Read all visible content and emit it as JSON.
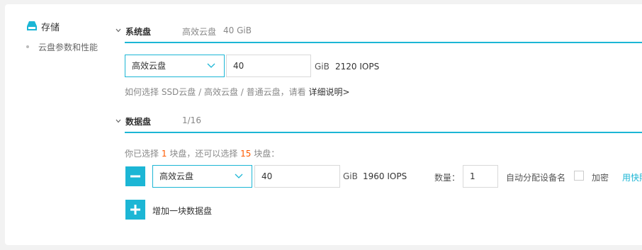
{
  "nav": {
    "title": "存储",
    "sub_item": "云盘参数和性能"
  },
  "system_disk": {
    "title": "系统盘",
    "summary_type": "高效云盘",
    "summary_size": "40 GiB",
    "type_value": "高效云盘",
    "size_value": "40",
    "unit": "GiB",
    "iops": "2120 IOPS",
    "hint_text": "如何选择 SSD云盘 / 高效云盘 / 普通云盘，请看",
    "hint_link": "详细说明>"
  },
  "data_disk": {
    "title": "数据盘",
    "count_summary": "1/16",
    "selected_prefix": "你已选择",
    "selected_count": "1",
    "selected_mid": "块盘，还可以选择",
    "remaining_count": "15",
    "selected_suffix": "块盘：",
    "type_value": "高效云盘",
    "size_value": "40",
    "unit": "GiB",
    "iops": "1960 IOPS",
    "quantity_label": "数量：",
    "quantity_value": "1",
    "auto_name_label": "自动分配设备名",
    "encrypt_label": "加密",
    "snapshot_link": "用快照",
    "add_label": "增加一块数据盘"
  },
  "colors": {
    "accent": "#1cb6d5",
    "highlight": "#ff5a00"
  },
  "icons": {
    "storage": "storage-icon",
    "collapse": "chevron-down-icon",
    "dropdown": "dropdown-arrow-icon",
    "remove": "minus-icon",
    "add": "plus-icon"
  }
}
